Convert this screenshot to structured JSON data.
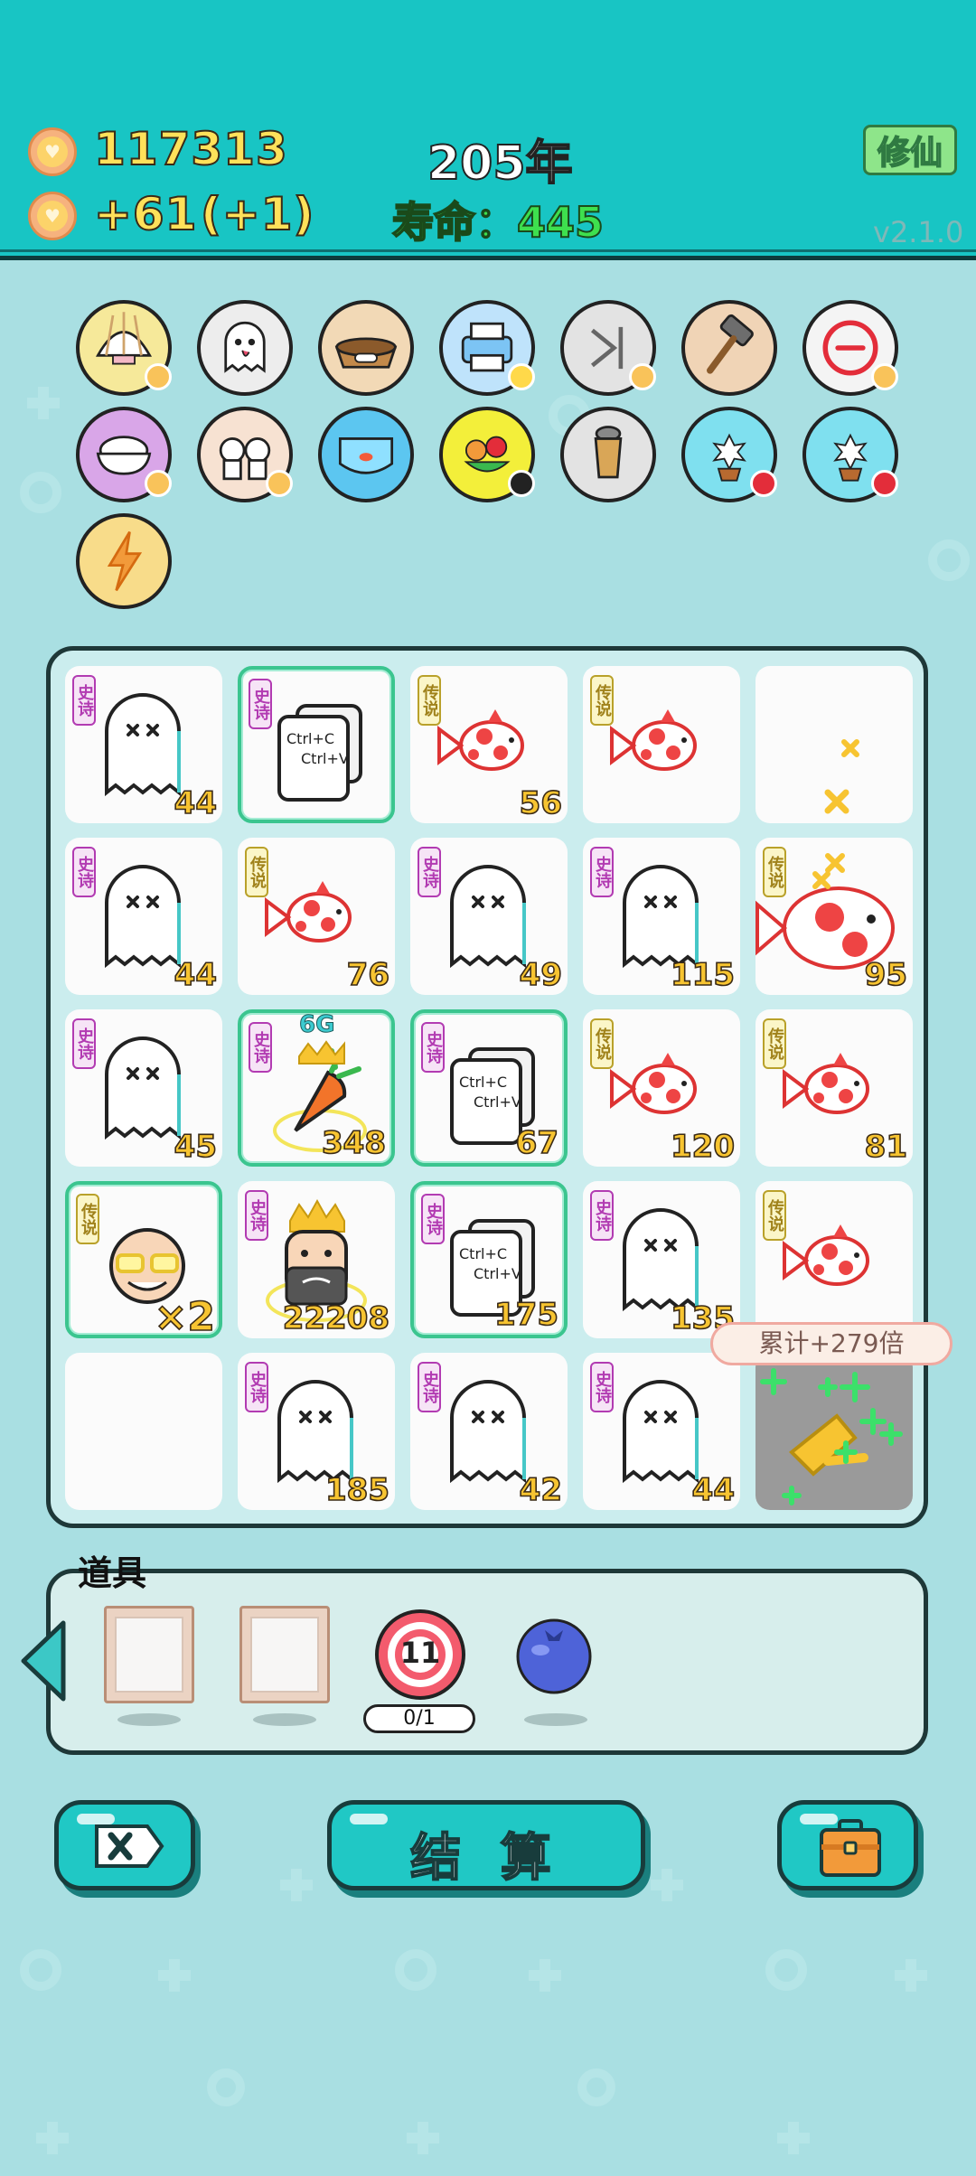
{
  "header": {
    "coins": "117313",
    "income": "+61",
    "income_bonus": "(+1)",
    "year": "205年",
    "life_label": "寿命：",
    "life_value": "445",
    "cultivate_button": "修仙",
    "version": "v2.1.0"
  },
  "item_icons": [
    {
      "name": "shell-icon",
      "badge": "heart"
    },
    {
      "name": "ghost-face-icon",
      "badge": ""
    },
    {
      "name": "pet-food-bowl-icon",
      "badge": ""
    },
    {
      "name": "printer-icon",
      "badge": "warning"
    },
    {
      "name": "skip-next-icon",
      "badge": "heart"
    },
    {
      "name": "hammer-icon",
      "badge": ""
    },
    {
      "name": "minus-circle-icon",
      "badge": "heart"
    },
    {
      "name": "rice-bowl-icon",
      "badge": "heart"
    },
    {
      "name": "twins-cow-icon",
      "badge": "heart"
    },
    {
      "name": "fish-tank-icon",
      "badge": ""
    },
    {
      "name": "fruit-plate-icon",
      "badge": "V"
    },
    {
      "name": "bubble-tea-icon",
      "badge": ""
    },
    {
      "name": "flower-pot-icon",
      "badge": "minus"
    },
    {
      "name": "flower-pot-icon",
      "badge": "minus"
    },
    {
      "name": "lightning-icon",
      "badge": ""
    }
  ],
  "board": {
    "cells": [
      {
        "tag": "史诗",
        "rarity": "epic",
        "art": "ghost",
        "value": "44",
        "selected": false
      },
      {
        "tag": "史诗",
        "rarity": "epic",
        "art": "copy",
        "value": "",
        "selected": true
      },
      {
        "tag": "传说",
        "rarity": "legend",
        "art": "fish",
        "value": "56",
        "selected": false
      },
      {
        "tag": "传说",
        "rarity": "legend",
        "art": "fish",
        "value": "",
        "selected": false
      },
      {
        "tag": "",
        "rarity": "",
        "art": "empty-x",
        "value": "",
        "selected": false
      },
      {
        "tag": "史诗",
        "rarity": "epic",
        "art": "ghost",
        "value": "44",
        "selected": false
      },
      {
        "tag": "传说",
        "rarity": "legend",
        "art": "fish",
        "value": "76",
        "selected": false
      },
      {
        "tag": "史诗",
        "rarity": "epic",
        "art": "ghost",
        "value": "49",
        "selected": false
      },
      {
        "tag": "史诗",
        "rarity": "epic",
        "art": "ghost",
        "value": "115",
        "selected": false
      },
      {
        "tag": "传说",
        "rarity": "legend",
        "art": "bigfish",
        "value": "95",
        "selected": false
      },
      {
        "tag": "史诗",
        "rarity": "epic",
        "art": "ghost",
        "value": "45",
        "selected": false
      },
      {
        "tag": "史诗",
        "rarity": "epic",
        "art": "carrot",
        "value": "348",
        "selected": true
      },
      {
        "tag": "史诗",
        "rarity": "epic",
        "art": "copy",
        "value": "67",
        "selected": true
      },
      {
        "tag": "传说",
        "rarity": "legend",
        "art": "fish",
        "value": "120",
        "selected": false
      },
      {
        "tag": "传说",
        "rarity": "legend",
        "art": "fish",
        "value": "81",
        "selected": false
      },
      {
        "tag": "传说",
        "rarity": "legend",
        "art": "oldman",
        "value": "×2",
        "selected": true
      },
      {
        "tag": "史诗",
        "rarity": "epic",
        "art": "king",
        "value": "22208",
        "selected": false
      },
      {
        "tag": "史诗",
        "rarity": "epic",
        "art": "copy",
        "value": "175",
        "selected": true
      },
      {
        "tag": "史诗",
        "rarity": "epic",
        "art": "ghost",
        "value": "135",
        "selected": false
      },
      {
        "tag": "传说",
        "rarity": "legend",
        "art": "fish",
        "value": "",
        "selected": false
      },
      {
        "tag": "",
        "rarity": "",
        "art": "empty",
        "value": "",
        "selected": false
      },
      {
        "tag": "史诗",
        "rarity": "epic",
        "art": "ghost",
        "value": "185",
        "selected": false
      },
      {
        "tag": "史诗",
        "rarity": "epic",
        "art": "ghost",
        "value": "42",
        "selected": false
      },
      {
        "tag": "史诗",
        "rarity": "epic",
        "art": "ghost",
        "value": "44",
        "selected": false
      },
      {
        "tag": "",
        "rarity": "",
        "art": "pointer",
        "value": "",
        "selected": false
      }
    ],
    "crown_label": "6G",
    "copy_text_1": "Ctrl+C",
    "copy_text_2": "Ctrl+V",
    "tooltip": "累计+279倍"
  },
  "props": {
    "title": "道具",
    "target_number": "11",
    "counter": "0/1"
  },
  "buttons": {
    "settle": "结 算"
  },
  "colors": {
    "header_bg": "#18c5c4",
    "page_bg": "#a9dfe2",
    "number_yellow": "#f7c431",
    "epic_purple": "#b23bb2",
    "legend_gold": "#b9a12a",
    "life_green": "#3ee04e"
  }
}
